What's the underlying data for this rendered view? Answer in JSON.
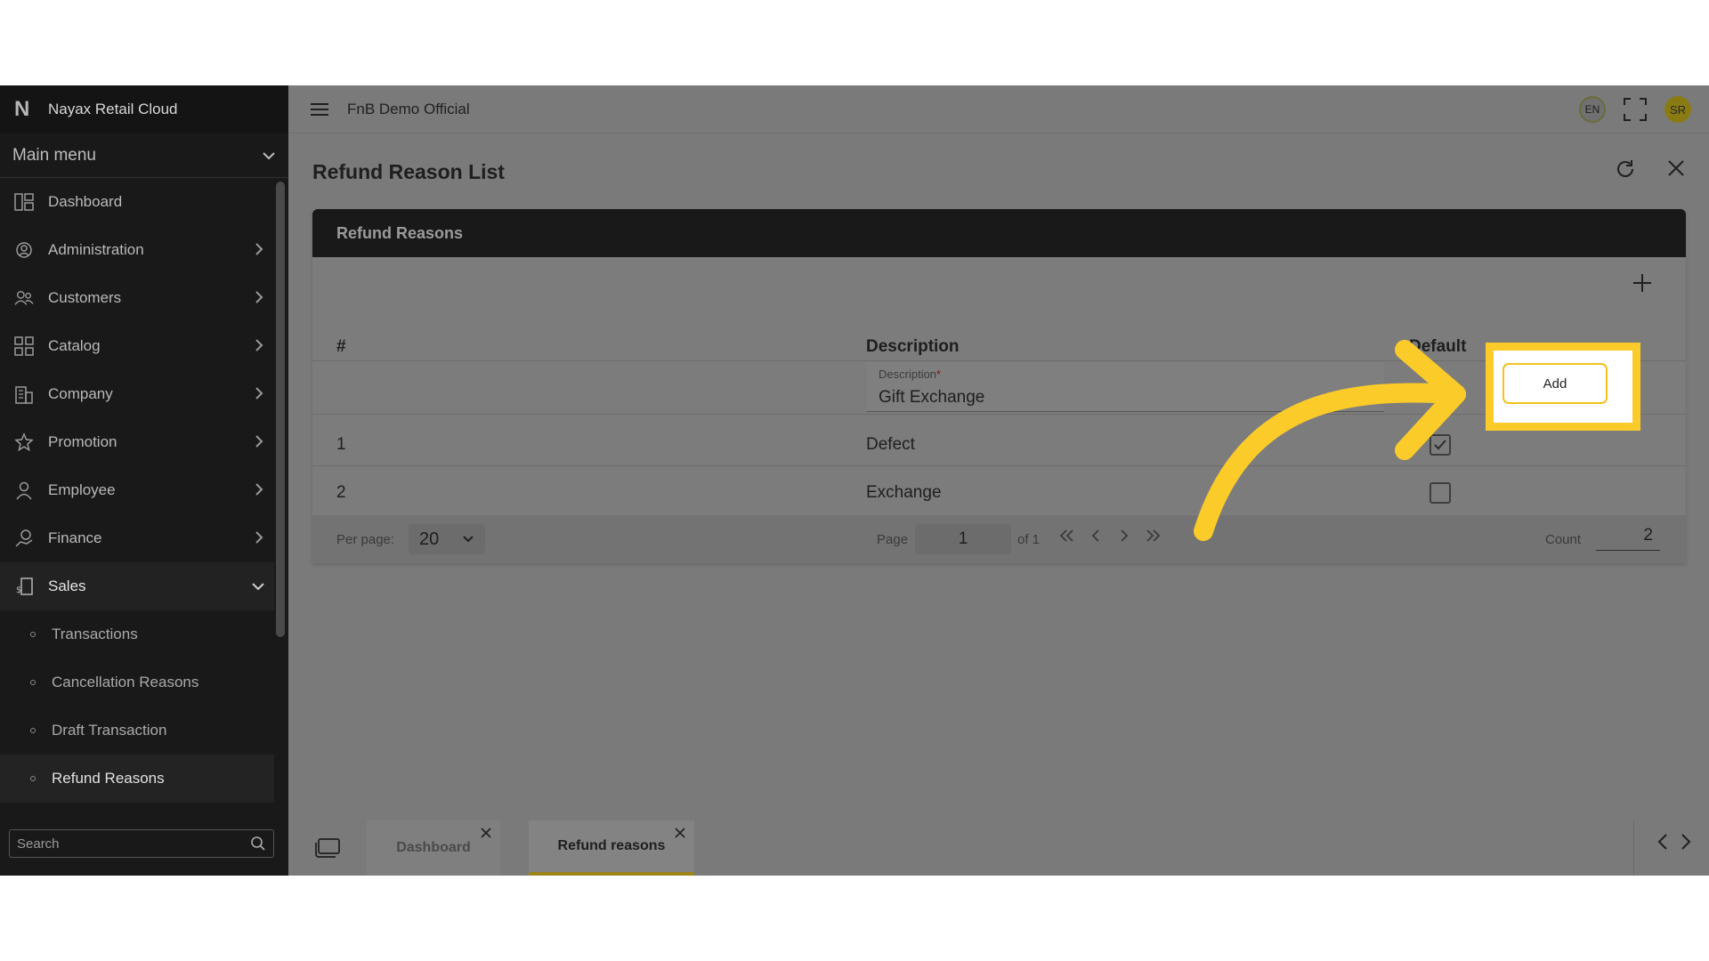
{
  "app": {
    "brand": "Nayax Retail Cloud",
    "company": "FnB Demo Official"
  },
  "sidebar": {
    "main_menu_label": "Main menu",
    "items": [
      {
        "label": "Dashboard",
        "icon": "dashboard-icon"
      },
      {
        "label": "Administration",
        "icon": "gear-user-icon"
      },
      {
        "label": "Customers",
        "icon": "users-icon"
      },
      {
        "label": "Catalog",
        "icon": "grid-icon"
      },
      {
        "label": "Company",
        "icon": "building-icon"
      },
      {
        "label": "Promotion",
        "icon": "star-icon"
      },
      {
        "label": "Employee",
        "icon": "person-icon"
      },
      {
        "label": "Finance",
        "icon": "finance-icon"
      },
      {
        "label": "Sales",
        "icon": "sales-icon"
      }
    ],
    "sales_sub": [
      "Transactions",
      "Cancellation Reasons",
      "Draft Transaction",
      "Refund Reasons"
    ],
    "search_placeholder": "Search"
  },
  "topbar": {
    "lang": "EN",
    "avatar": "SR"
  },
  "page": {
    "title": "Refund Reason List"
  },
  "card": {
    "title": "Refund Reasons",
    "columns": {
      "num": "#",
      "description": "Description",
      "default": "Default"
    },
    "new_row": {
      "field_label": "Description",
      "required_mark": "*",
      "value": "Gift Exchange",
      "add_label": "Add"
    },
    "rows": [
      {
        "num": "1",
        "description": "Defect",
        "default": true
      },
      {
        "num": "2",
        "description": "Exchange",
        "default": false
      }
    ],
    "footer": {
      "per_page_label": "Per page:",
      "per_page_value": "20",
      "page_label": "Page",
      "page_value": "1",
      "of_label": "of 1",
      "count_label": "Count",
      "count_value": "2"
    }
  },
  "tabs": [
    {
      "label": "Dashboard"
    },
    {
      "label": "Refund reasons",
      "active": true
    }
  ],
  "colors": {
    "highlight": "#fbcb2a",
    "active_tab_underline": "#9d8418"
  }
}
